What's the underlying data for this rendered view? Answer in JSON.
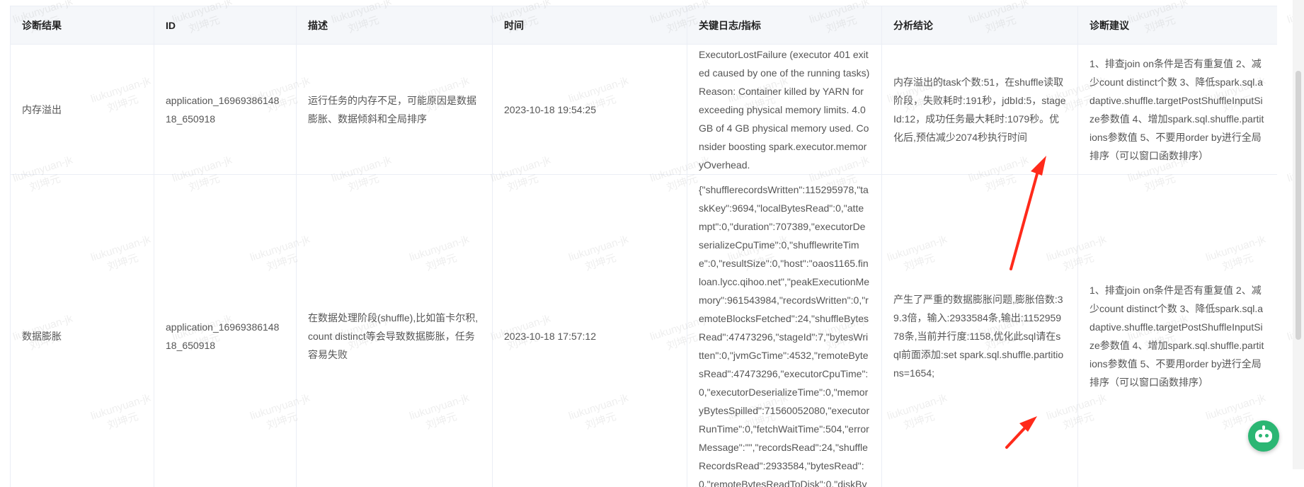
{
  "table": {
    "headers": [
      "诊断结果",
      "ID",
      "描述",
      "时间",
      "关键日志/指标",
      "分析结论",
      "诊断建议"
    ],
    "rows": [
      {
        "result": "内存溢出",
        "id": "application_1696938614818_650918",
        "description": "运行任务的内存不足，可能原因是数据膨胀、数据倾斜和全局排序",
        "time": "2023-10-18 19:54:25",
        "log": "ExecutorLostFailure (executor 401 exited caused by one of the running tasks) Reason: Container killed by YARN for exceeding physical memory limits. 4.0 GB of 4 GB physical memory used. Consider boosting spark.executor.memoryOverhead.",
        "conclusion": "内存溢出的task个数:51，在shuffle读取阶段，失败耗时:191秒，jdbId:5，stageId:12，成功任务最大耗时:1079秒。优化后,预估减少2074秒执行时间",
        "suggestion": "1、排查join on条件是否有重复值 2、减少count distinct个数 3、降低spark.sql.adaptive.shuffle.targetPostShuffleInputSize参数值 4、增加spark.sql.shuffle.partitions参数值 5、不要用order by进行全局排序（可以窗口函数排序）"
      },
      {
        "result": "数据膨胀",
        "id": "application_1696938614818_650918",
        "description": "在数据处理阶段(shuffle),比如笛卡尔积,count distinct等会导致数据膨胀，任务容易失败",
        "time": "2023-10-18 17:57:12",
        "log": "{\"shufflerecordsWritten\":115295978,\"taskKey\":9694,\"localBytesRead\":0,\"attempt\":0,\"duration\":707389,\"executorDeserializeCpuTime\":0,\"shufflewriteTime\":0,\"resultSize\":0,\"host\":\"oaos1165.finloan.lycc.qihoo.net\",\"peakExecutionMemory\":961543984,\"recordsWritten\":0,\"remoteBlocksFetched\":24,\"shuffleBytesRead\":47473296,\"stageId\":7,\"bytesWritten\":0,\"jvmGcTime\":4532,\"remoteBytesRead\":47473296,\"executorCpuTime\":0,\"executorDeserializeTime\":0,\"memoryBytesSpilled\":71560052080,\"executorRunTime\":0,\"fetchWaitTime\":504,\"errorMessage\":\"\",\"recordsRead\":24,\"shuffleRecordsRead\":2933584,\"bytesRead\":0,\"remoteBytesReadToDisk\":0,\"diskBy",
        "conclusion": "产生了严重的数据膨胀问题,膨胀倍数:39.3倍，输入:2933584条,输出:115295978条,当前并行度:1158,优化此sql请在sql前面添加:set spark.sql.shuffle.partitions=1654;",
        "suggestion": "1、排查join on条件是否有重复值 2、减少count distinct个数 3、降低spark.sql.adaptive.shuffle.targetPostShuffleInputSize参数值 4、增加spark.sql.shuffle.partitions参数值 5、不要用order by进行全局排序（可以窗口函数排序）"
      }
    ]
  },
  "watermark": {
    "user": "liukunyuan-jk",
    "name": "刘坤元"
  },
  "colors": {
    "header_bg": "#f5f7fa",
    "border": "#ebeef5",
    "arrow": "#ff2a1a",
    "bot": "#2bb673"
  },
  "icons": {
    "assistant": "robot-icon"
  }
}
